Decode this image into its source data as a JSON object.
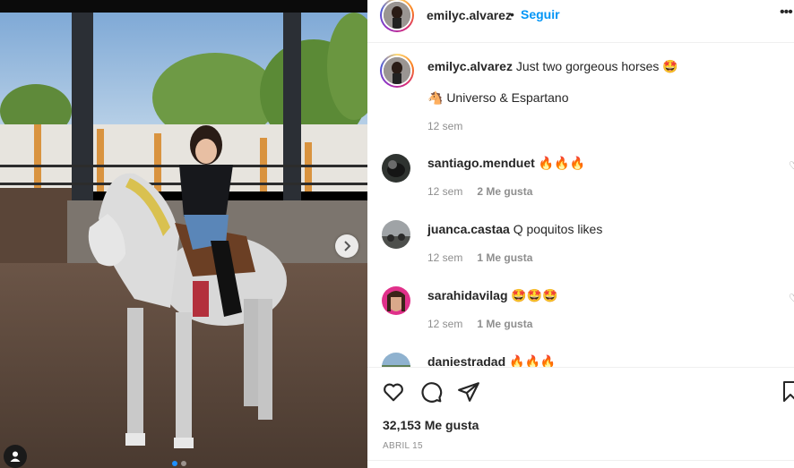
{
  "post": {
    "username": "emilyc.alvarez",
    "separator": "•",
    "follow_label": "Seguir",
    "more_label": "•••",
    "caption": {
      "text": "Just two gorgeous horses 🤩",
      "second_line": "🐴 Universo & Espartano",
      "time": "12 sem"
    }
  },
  "comments": [
    {
      "username": "santiago.menduet",
      "text": "🔥🔥🔥",
      "time": "12 sem",
      "likes": "2 Me gusta"
    },
    {
      "username": "juanca.castaa",
      "text": "Q poquitos likes",
      "time": "12 sem",
      "likes": "1 Me gusta"
    },
    {
      "username": "sarahidavilag",
      "text": "🤩🤩🤩",
      "time": "12 sem",
      "likes": "1 Me gusta"
    },
    {
      "username": "daniestradad",
      "text": "🔥🔥🔥",
      "time": "",
      "likes": ""
    }
  ],
  "footer": {
    "likes_count": "32,153 Me gusta",
    "date": "ABRIL 15"
  },
  "icons": {
    "heart": "heart-icon",
    "comment": "comment-icon",
    "share": "share-icon",
    "bookmark": "bookmark-icon",
    "next": "chevron-right-icon",
    "tag": "user-tag-icon"
  },
  "carousel": {
    "total": 2,
    "current": 1
  },
  "colors": {
    "accent": "#0095f6",
    "muted": "#8e8e8e",
    "text": "#262626"
  }
}
